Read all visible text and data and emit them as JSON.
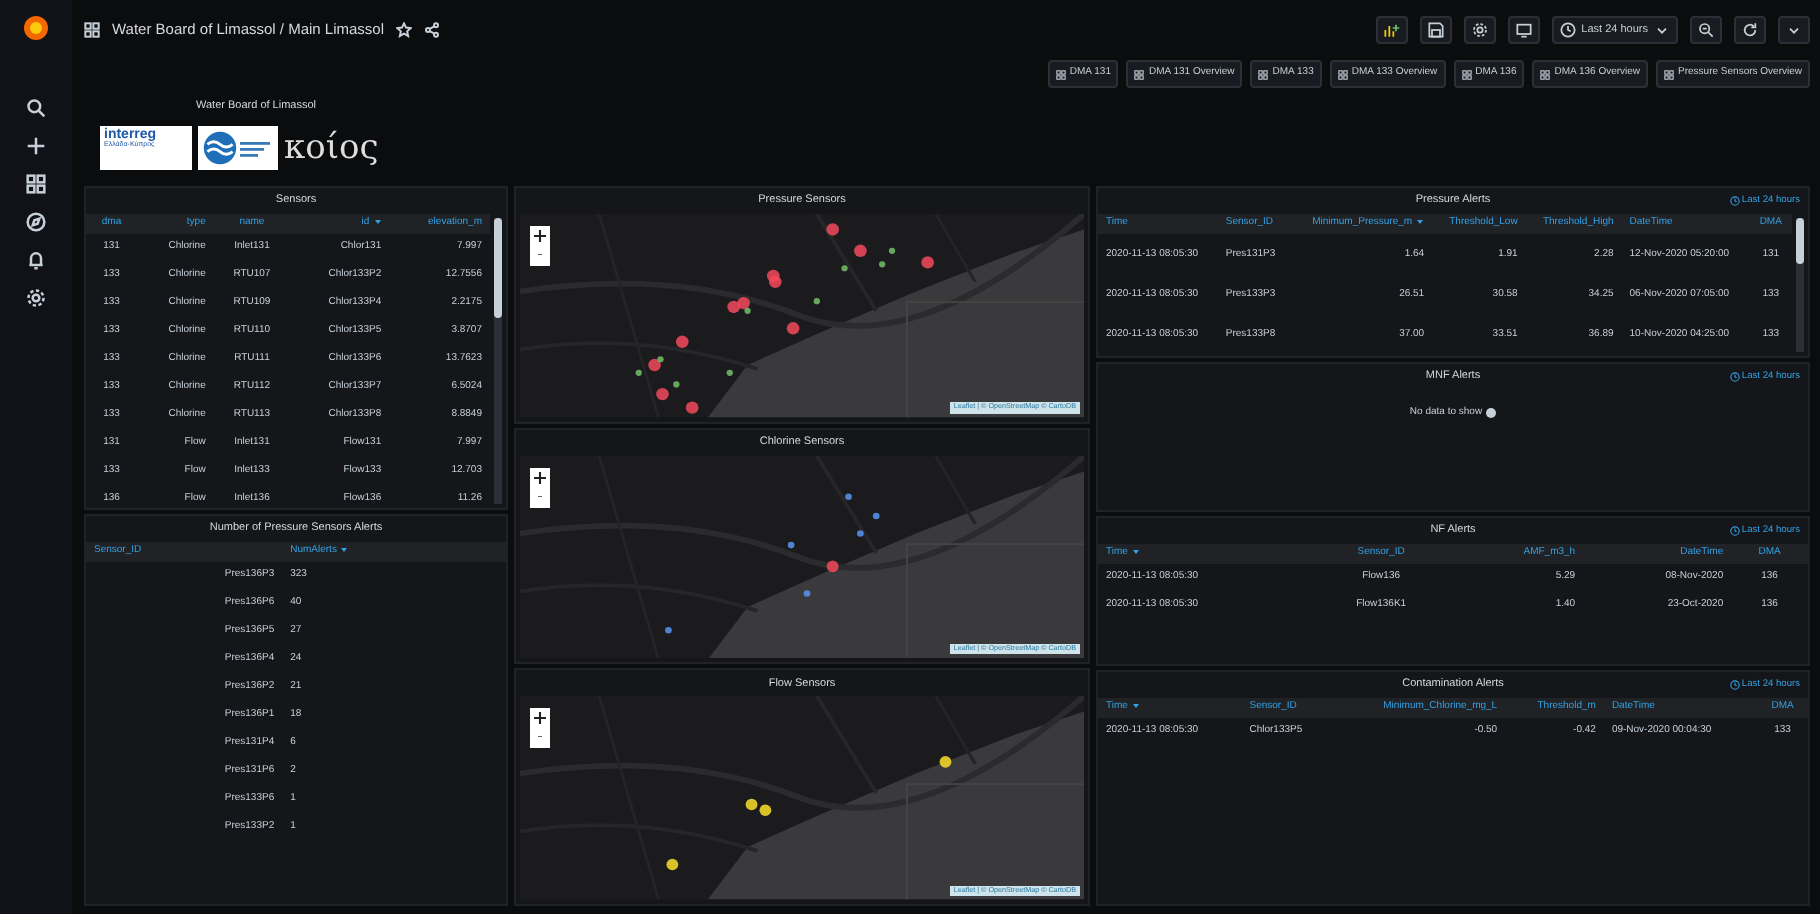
{
  "topbar": {
    "breadcrumb": "Water Board of Limassol / Main Limassol",
    "time_range": "Last 24 hours"
  },
  "dashboard_links": [
    "DMA 131",
    "DMA 131 Overview",
    "DMA 133",
    "DMA 133 Overview",
    "DMA 136",
    "DMA 136 Overview",
    "Pressure Sensors Overview"
  ],
  "header": {
    "title": "Water Board of Limassol",
    "interreg": "interreg",
    "interreg_sub": "Ελλάδα-Κύπρος",
    "koios": "κοίος"
  },
  "sensors": {
    "title": "Sensors",
    "columns": [
      {
        "label": "dma",
        "sorted": false
      },
      {
        "label": "type",
        "sorted": false
      },
      {
        "label": "name",
        "sorted": false
      },
      {
        "label": "id",
        "sorted": true
      },
      {
        "label": "elevation_m",
        "sorted": false
      }
    ],
    "rows": [
      [
        "131",
        "Chlorine",
        "Inlet131",
        "Chlor131",
        "7.997"
      ],
      [
        "133",
        "Chlorine",
        "RTU107",
        "Chlor133P2",
        "12.7556"
      ],
      [
        "133",
        "Chlorine",
        "RTU109",
        "Chlor133P4",
        "2.2175"
      ],
      [
        "133",
        "Chlorine",
        "RTU110",
        "Chlor133P5",
        "3.8707"
      ],
      [
        "133",
        "Chlorine",
        "RTU111",
        "Chlor133P6",
        "13.7623"
      ],
      [
        "133",
        "Chlorine",
        "RTU112",
        "Chlor133P7",
        "6.5024"
      ],
      [
        "133",
        "Chlorine",
        "RTU113",
        "Chlor133P8",
        "8.8849"
      ],
      [
        "131",
        "Flow",
        "Inlet131",
        "Flow131",
        "7.997"
      ],
      [
        "133",
        "Flow",
        "Inlet133",
        "Flow133",
        "12.703"
      ],
      [
        "136",
        "Flow",
        "Inlet136",
        "Flow136",
        "11.26"
      ]
    ]
  },
  "alert_counts": {
    "title": "Number of Pressure Sensors Alerts",
    "columns": [
      {
        "label": "Sensor_ID",
        "sorted": false
      },
      {
        "label": "NumAlerts",
        "sorted": true
      }
    ],
    "rows": [
      [
        "Pres136P3",
        "323"
      ],
      [
        "Pres136P6",
        "40"
      ],
      [
        "Pres136P5",
        "27"
      ],
      [
        "Pres136P4",
        "24"
      ],
      [
        "Pres136P2",
        "21"
      ],
      [
        "Pres136P1",
        "18"
      ],
      [
        "Pres131P4",
        "6"
      ],
      [
        "Pres131P6",
        "2"
      ],
      [
        "Pres133P6",
        "1"
      ],
      [
        "Pres133P2",
        "1"
      ]
    ]
  },
  "maps": [
    {
      "title": "Pressure Sensors",
      "attribution": "Leaflet | © OpenStreetMap © CartoDB"
    },
    {
      "title": "Chlorine Sensors",
      "attribution": "Leaflet | © OpenStreetMap © CartoDB"
    },
    {
      "title": "Flow Sensors",
      "attribution": "Leaflet | © OpenStreetMap © CartoDB"
    }
  ],
  "pressure_alerts": {
    "title": "Pressure Alerts",
    "time_info": "Last 24 hours",
    "columns": [
      {
        "label": "Time",
        "sorted": false
      },
      {
        "label": "Sensor_ID",
        "sorted": false
      },
      {
        "label": "Minimum_Pressure_m",
        "sorted": true
      },
      {
        "label": "Threshold_Low",
        "sorted": false
      },
      {
        "label": "Threshold_High",
        "sorted": false
      },
      {
        "label": "DateTime",
        "sorted": false
      },
      {
        "label": "DMA",
        "sorted": false
      }
    ],
    "rows": [
      [
        "2020-11-13 08:05:30",
        "Pres131P3",
        "1.64",
        "1.91",
        "2.28",
        "12-Nov-2020 05:20:00",
        "131"
      ],
      [
        "2020-11-13 08:05:30",
        "Pres133P3",
        "26.51",
        "30.58",
        "34.25",
        "06-Nov-2020 07:05:00",
        "133"
      ],
      [
        "2020-11-13 08:05:30",
        "Pres133P8",
        "37.00",
        "33.51",
        "36.89",
        "10-Nov-2020 04:25:00",
        "133"
      ]
    ]
  },
  "mnf_alerts": {
    "title": "MNF Alerts",
    "time_info": "Last 24 hours",
    "no_data": "No data to show"
  },
  "nf_alerts": {
    "title": "NF Alerts",
    "time_info": "Last 24 hours",
    "columns": [
      {
        "label": "Time",
        "sorted": true
      },
      {
        "label": "Sensor_ID",
        "sorted": false
      },
      {
        "label": "AMF_m3_h",
        "sorted": false
      },
      {
        "label": "DateTime",
        "sorted": false
      },
      {
        "label": "DMA",
        "sorted": false
      }
    ],
    "rows": [
      [
        "2020-11-13 08:05:30",
        "Flow136",
        "5.29",
        "08-Nov-2020",
        "136"
      ],
      [
        "2020-11-13 08:05:30",
        "Flow136K1",
        "1.40",
        "23-Oct-2020",
        "136"
      ]
    ]
  },
  "contamination_alerts": {
    "title": "Contamination Alerts",
    "time_info": "Last 24 hours",
    "columns": [
      {
        "label": "Time",
        "sorted": true
      },
      {
        "label": "Sensor_ID",
        "sorted": false
      },
      {
        "label": "Minimum_Chlorine_mg_L",
        "sorted": false
      },
      {
        "label": "Threshold_m",
        "sorted": false
      },
      {
        "label": "DateTime",
        "sorted": false
      },
      {
        "label": "DMA",
        "sorted": false
      }
    ],
    "rows": [
      [
        "2020-11-13 08:05:30",
        "Chlor133P5",
        "-0.50",
        "-0.42",
        "09-Nov-2020 00:04:30",
        "133"
      ]
    ]
  }
}
